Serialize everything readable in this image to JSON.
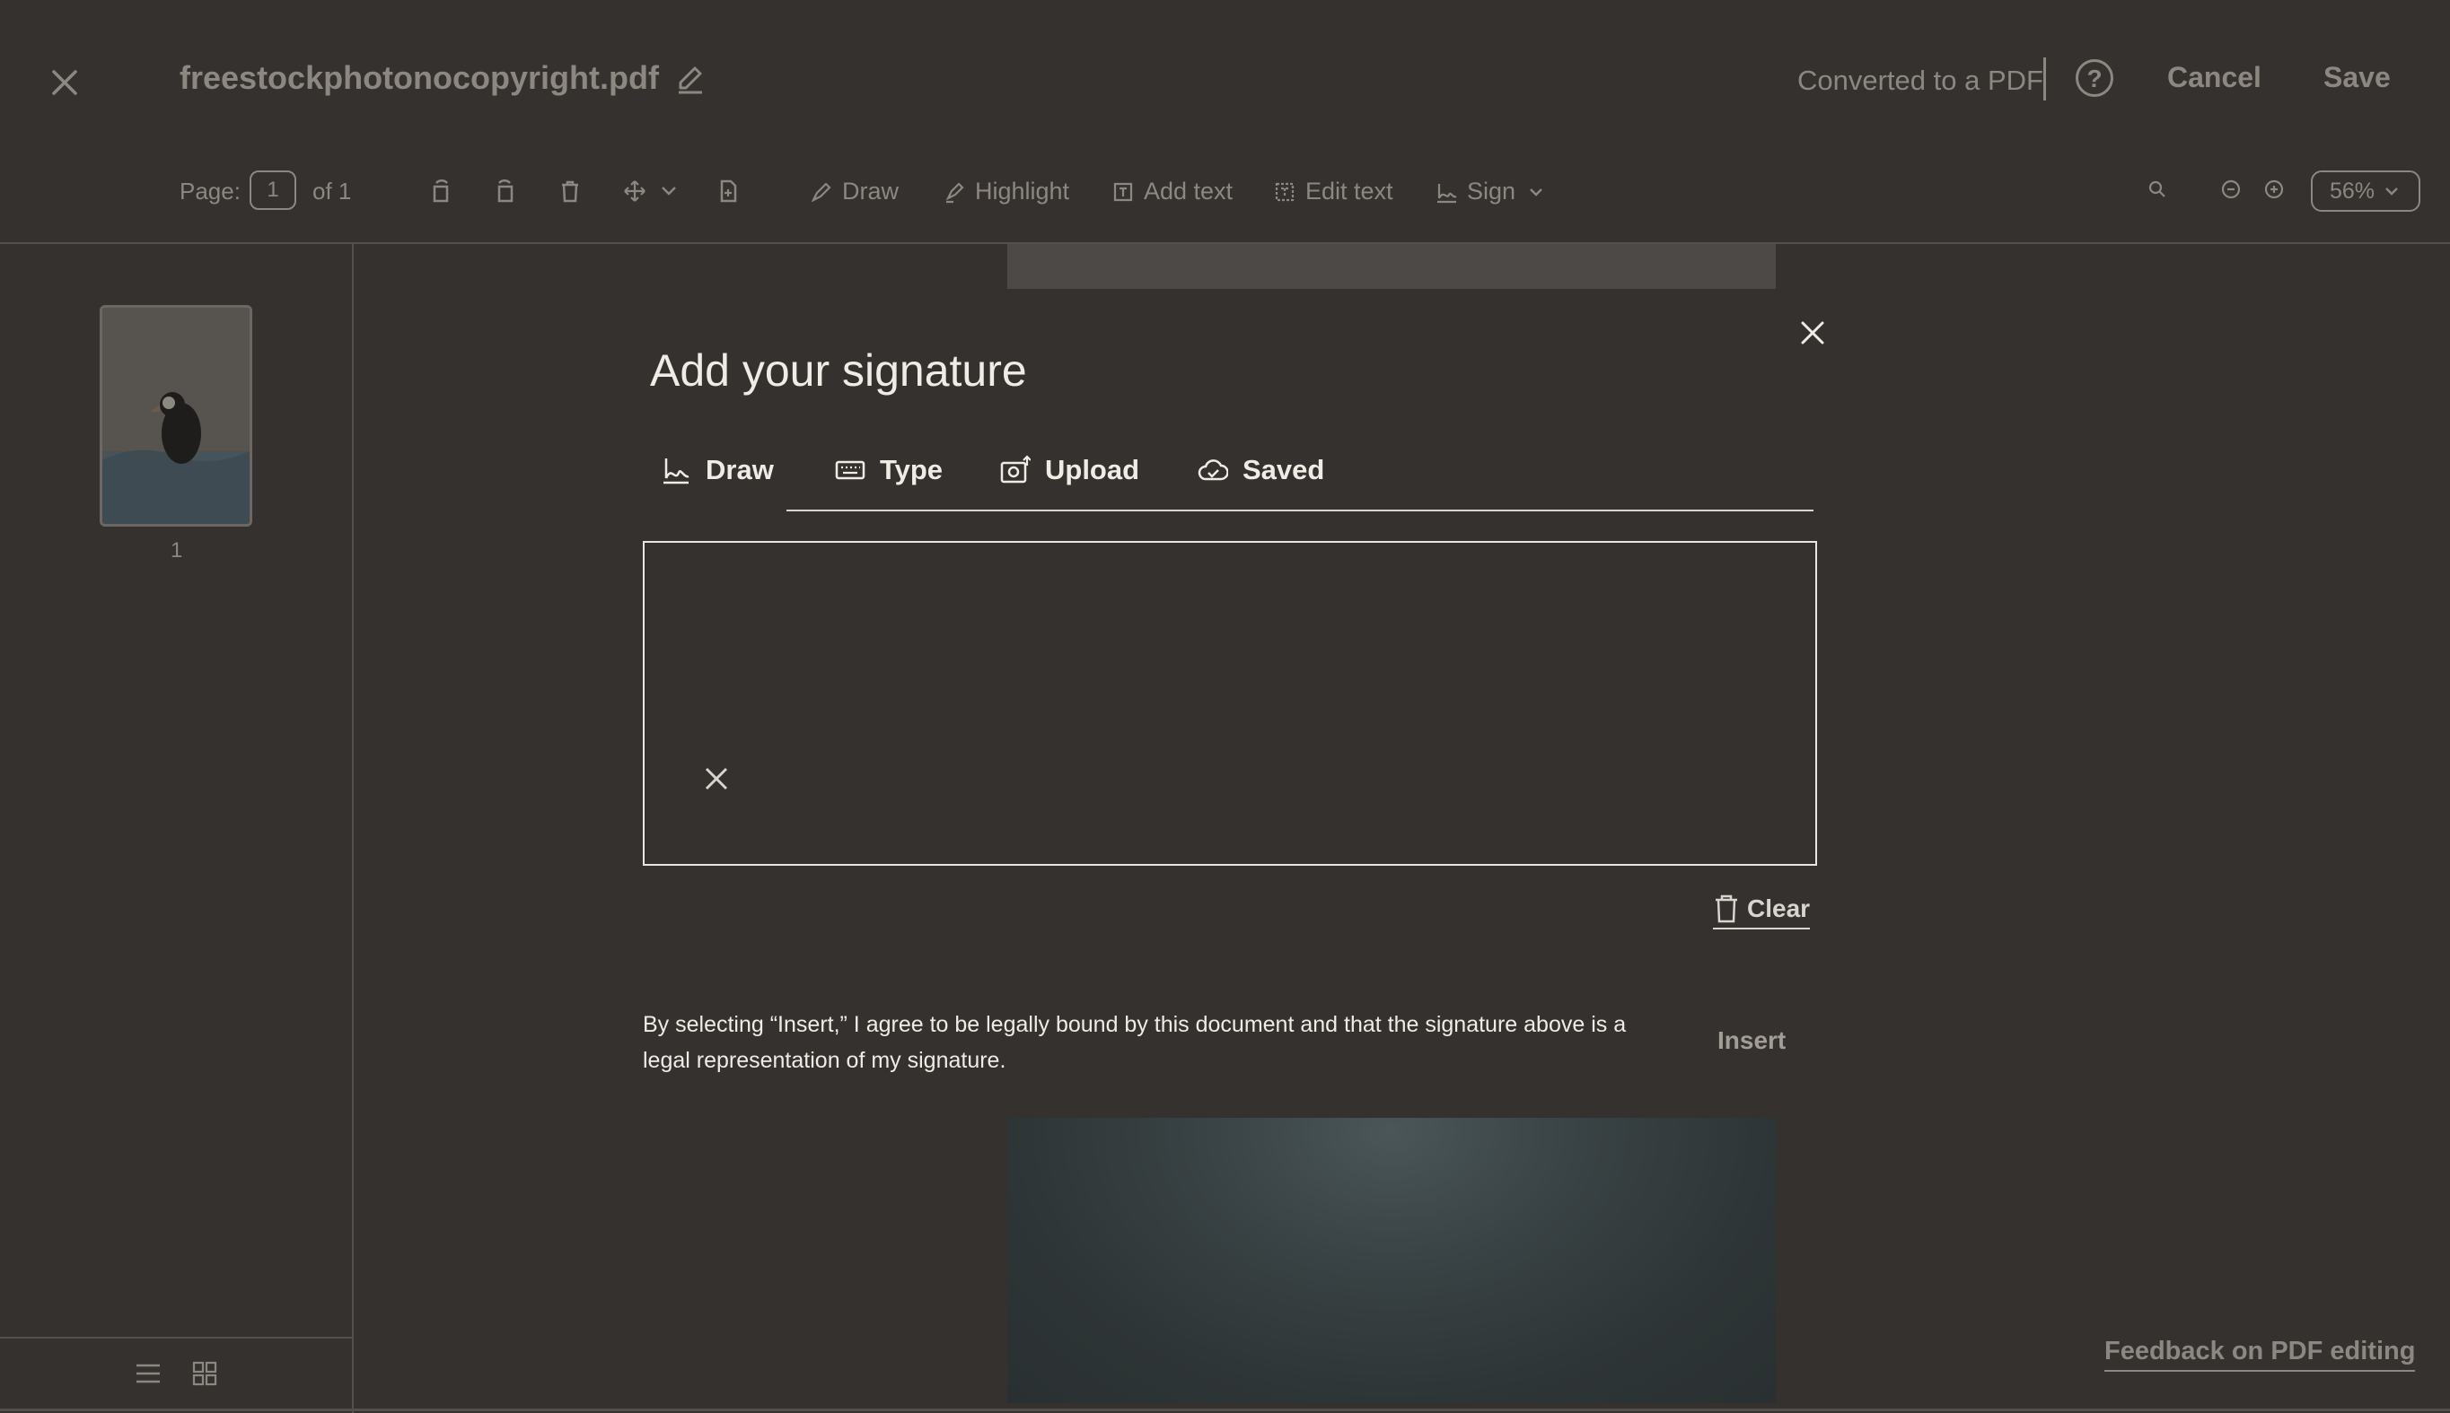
{
  "header": {
    "filename": "freestockphotonocopyright.pdf",
    "status": "Converted to a PDF",
    "help_label": "?",
    "cancel_label": "Cancel",
    "save_label": "Save"
  },
  "toolbar": {
    "page_label": "Page:",
    "page_value": "1",
    "page_total": "of 1",
    "tools": {
      "draw": "Draw",
      "highlight": "Highlight",
      "add_text": "Add text",
      "edit_text": "Edit text",
      "sign": "Sign"
    },
    "zoom": "56%"
  },
  "sidebar": {
    "thumbnail_page": "1"
  },
  "modal": {
    "title": "Add your signature",
    "tabs": {
      "draw": "Draw",
      "type": "Type",
      "upload": "Upload",
      "saved": "Saved"
    },
    "clear_label": "Clear",
    "legal_text": "By selecting “Insert,” I agree to be legally bound by this document and that the signature above is a legal representation of my signature.",
    "insert_label": "Insert"
  },
  "footer": {
    "feedback_label": "Feedback on PDF editing"
  }
}
